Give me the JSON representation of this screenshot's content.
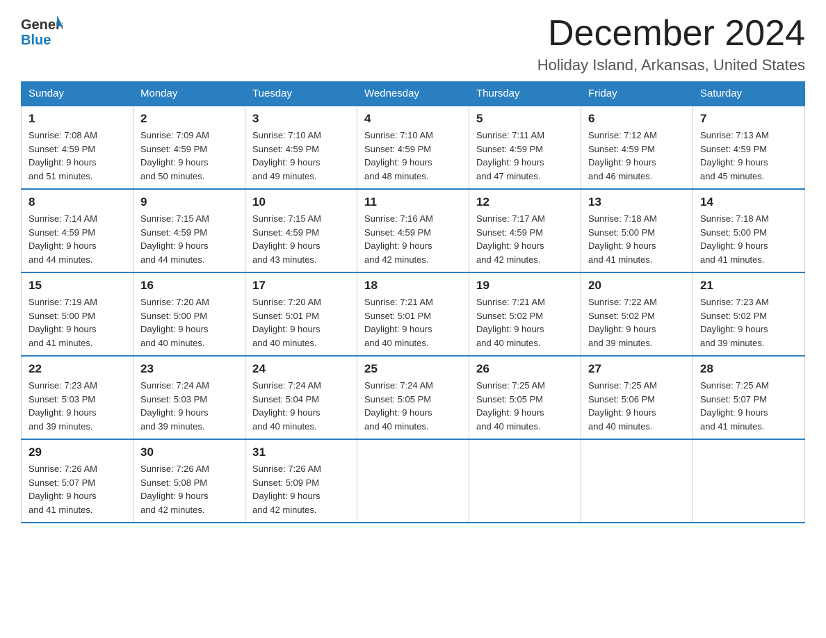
{
  "header": {
    "logo_general": "General",
    "logo_blue": "Blue",
    "month_title": "December 2024",
    "location": "Holiday Island, Arkansas, United States"
  },
  "days_of_week": [
    "Sunday",
    "Monday",
    "Tuesday",
    "Wednesday",
    "Thursday",
    "Friday",
    "Saturday"
  ],
  "weeks": [
    [
      {
        "num": "1",
        "sunrise": "7:08 AM",
        "sunset": "4:59 PM",
        "daylight": "9 hours and 51 minutes."
      },
      {
        "num": "2",
        "sunrise": "7:09 AM",
        "sunset": "4:59 PM",
        "daylight": "9 hours and 50 minutes."
      },
      {
        "num": "3",
        "sunrise": "7:10 AM",
        "sunset": "4:59 PM",
        "daylight": "9 hours and 49 minutes."
      },
      {
        "num": "4",
        "sunrise": "7:10 AM",
        "sunset": "4:59 PM",
        "daylight": "9 hours and 48 minutes."
      },
      {
        "num": "5",
        "sunrise": "7:11 AM",
        "sunset": "4:59 PM",
        "daylight": "9 hours and 47 minutes."
      },
      {
        "num": "6",
        "sunrise": "7:12 AM",
        "sunset": "4:59 PM",
        "daylight": "9 hours and 46 minutes."
      },
      {
        "num": "7",
        "sunrise": "7:13 AM",
        "sunset": "4:59 PM",
        "daylight": "9 hours and 45 minutes."
      }
    ],
    [
      {
        "num": "8",
        "sunrise": "7:14 AM",
        "sunset": "4:59 PM",
        "daylight": "9 hours and 44 minutes."
      },
      {
        "num": "9",
        "sunrise": "7:15 AM",
        "sunset": "4:59 PM",
        "daylight": "9 hours and 44 minutes."
      },
      {
        "num": "10",
        "sunrise": "7:15 AM",
        "sunset": "4:59 PM",
        "daylight": "9 hours and 43 minutes."
      },
      {
        "num": "11",
        "sunrise": "7:16 AM",
        "sunset": "4:59 PM",
        "daylight": "9 hours and 42 minutes."
      },
      {
        "num": "12",
        "sunrise": "7:17 AM",
        "sunset": "4:59 PM",
        "daylight": "9 hours and 42 minutes."
      },
      {
        "num": "13",
        "sunrise": "7:18 AM",
        "sunset": "5:00 PM",
        "daylight": "9 hours and 41 minutes."
      },
      {
        "num": "14",
        "sunrise": "7:18 AM",
        "sunset": "5:00 PM",
        "daylight": "9 hours and 41 minutes."
      }
    ],
    [
      {
        "num": "15",
        "sunrise": "7:19 AM",
        "sunset": "5:00 PM",
        "daylight": "9 hours and 41 minutes."
      },
      {
        "num": "16",
        "sunrise": "7:20 AM",
        "sunset": "5:00 PM",
        "daylight": "9 hours and 40 minutes."
      },
      {
        "num": "17",
        "sunrise": "7:20 AM",
        "sunset": "5:01 PM",
        "daylight": "9 hours and 40 minutes."
      },
      {
        "num": "18",
        "sunrise": "7:21 AM",
        "sunset": "5:01 PM",
        "daylight": "9 hours and 40 minutes."
      },
      {
        "num": "19",
        "sunrise": "7:21 AM",
        "sunset": "5:02 PM",
        "daylight": "9 hours and 40 minutes."
      },
      {
        "num": "20",
        "sunrise": "7:22 AM",
        "sunset": "5:02 PM",
        "daylight": "9 hours and 39 minutes."
      },
      {
        "num": "21",
        "sunrise": "7:23 AM",
        "sunset": "5:02 PM",
        "daylight": "9 hours and 39 minutes."
      }
    ],
    [
      {
        "num": "22",
        "sunrise": "7:23 AM",
        "sunset": "5:03 PM",
        "daylight": "9 hours and 39 minutes."
      },
      {
        "num": "23",
        "sunrise": "7:24 AM",
        "sunset": "5:03 PM",
        "daylight": "9 hours and 39 minutes."
      },
      {
        "num": "24",
        "sunrise": "7:24 AM",
        "sunset": "5:04 PM",
        "daylight": "9 hours and 40 minutes."
      },
      {
        "num": "25",
        "sunrise": "7:24 AM",
        "sunset": "5:05 PM",
        "daylight": "9 hours and 40 minutes."
      },
      {
        "num": "26",
        "sunrise": "7:25 AM",
        "sunset": "5:05 PM",
        "daylight": "9 hours and 40 minutes."
      },
      {
        "num": "27",
        "sunrise": "7:25 AM",
        "sunset": "5:06 PM",
        "daylight": "9 hours and 40 minutes."
      },
      {
        "num": "28",
        "sunrise": "7:25 AM",
        "sunset": "5:07 PM",
        "daylight": "9 hours and 41 minutes."
      }
    ],
    [
      {
        "num": "29",
        "sunrise": "7:26 AM",
        "sunset": "5:07 PM",
        "daylight": "9 hours and 41 minutes."
      },
      {
        "num": "30",
        "sunrise": "7:26 AM",
        "sunset": "5:08 PM",
        "daylight": "9 hours and 42 minutes."
      },
      {
        "num": "31",
        "sunrise": "7:26 AM",
        "sunset": "5:09 PM",
        "daylight": "9 hours and 42 minutes."
      },
      null,
      null,
      null,
      null
    ]
  ],
  "labels": {
    "sunrise": "Sunrise:",
    "sunset": "Sunset:",
    "daylight": "Daylight:"
  }
}
